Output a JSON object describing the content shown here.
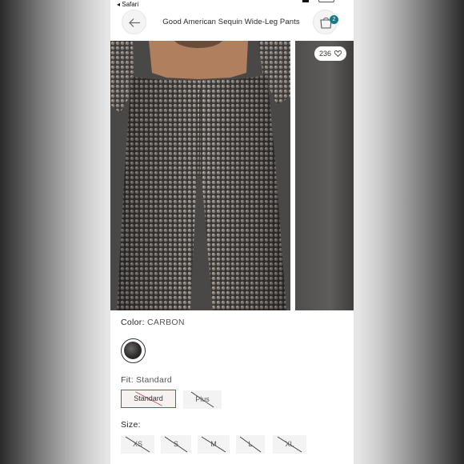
{
  "status_bar": {
    "back_app": "◂ Safari"
  },
  "header": {
    "title": "Good American Sequin Wide-Leg Pants",
    "bag_count": "2"
  },
  "gallery": {
    "likes": "236"
  },
  "color": {
    "label": "Color:",
    "value": "CARBON"
  },
  "fit": {
    "label": "Fit:",
    "value": "Standard",
    "options": [
      "Standard",
      "Plus"
    ],
    "selected": "Standard"
  },
  "size": {
    "label": "Size:",
    "options": [
      "XS",
      "S",
      "M",
      "L",
      "XL"
    ]
  },
  "colors": {
    "badge": "#117c86",
    "selected_border": "#c0393b"
  },
  "icons": {
    "back": "arrow-left-icon",
    "bag": "shopping-bag-icon",
    "like": "heart-icon"
  }
}
